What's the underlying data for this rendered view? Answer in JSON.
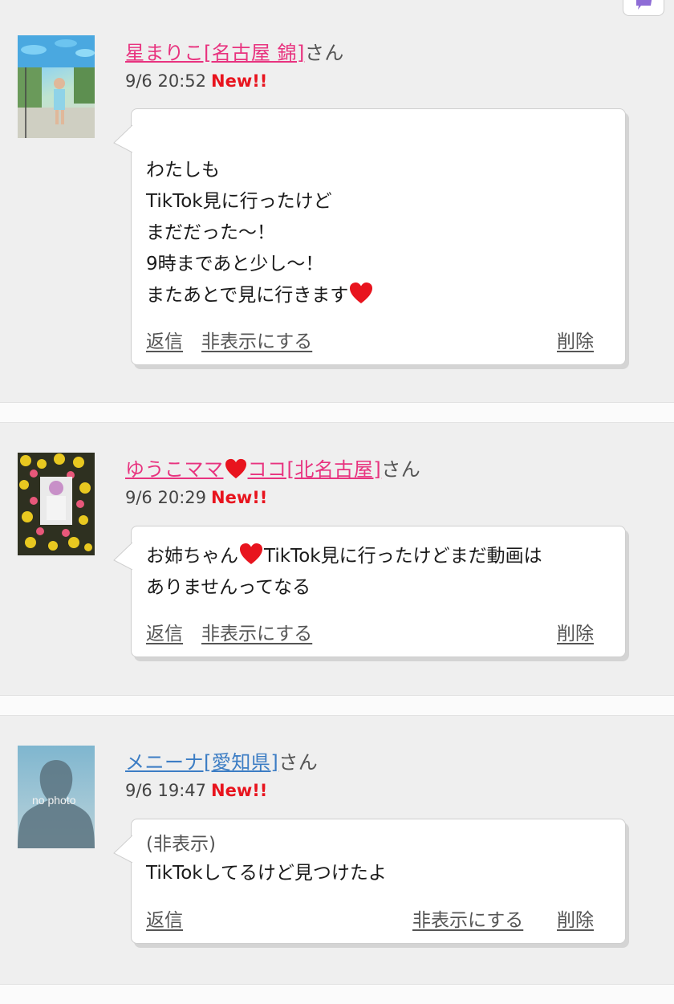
{
  "comments": [
    {
      "name": "星まりこ[名古屋 錦]",
      "honorific": "さん",
      "time": "9/6 20:52",
      "badge": "New!!",
      "lines": [
        "わたしも",
        "TikTok見に行ったけど",
        "まだだった〜！",
        "9時まであと少し〜！",
        "またあとで見に行きます"
      ],
      "actions": {
        "reply": "返信",
        "hide": "非表示にする",
        "delete": "削除"
      }
    },
    {
      "name_part1": "ゆうこママ",
      "name_part2": "ココ[北名古屋]",
      "honorific": "さん",
      "time": "9/6 20:29",
      "badge": "New!!",
      "line1_a": "お姉ちゃん",
      "line1_b": "TikTok見に行ったけどまだ動画は",
      "line2": "ありませんってなる",
      "actions": {
        "reply": "返信",
        "hide": "非表示にする",
        "delete": "削除"
      }
    },
    {
      "name": "メニーナ[愛知県]",
      "honorific": "さん",
      "time": "9/6 19:47",
      "badge": "New!!",
      "avatar_text": "no photo",
      "hidden_label": "(非表示)",
      "message": "TikTokしてるけど見つけたよ",
      "actions": {
        "reply": "返信",
        "hide": "非表示にする",
        "delete": "削除"
      }
    }
  ],
  "colors": {
    "name_pink": "#e8337f",
    "name_blue": "#3c7dc4",
    "new_red": "#e8141e",
    "heart": "#e8141e",
    "background": "#efefef"
  },
  "icons": {
    "corner": "compose-icon",
    "heart": "heart-icon"
  }
}
